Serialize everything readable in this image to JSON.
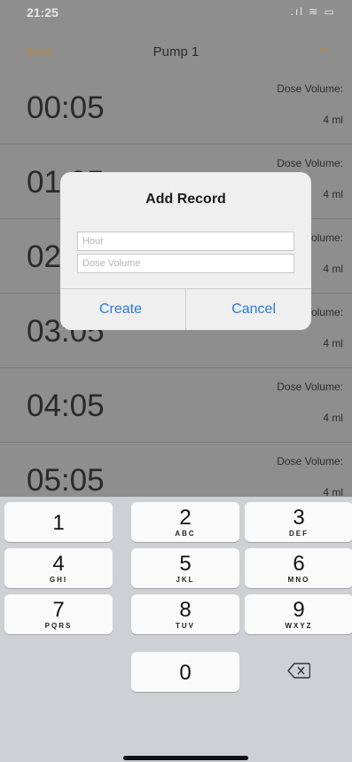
{
  "status": {
    "time": "21:25",
    "signal": ".ıl",
    "battery": "▢"
  },
  "nav": {
    "save_label": "Save",
    "title": "Pump 1",
    "add_label": "+"
  },
  "records": [
    {
      "time": "00:05",
      "dose_label": "Dose Volume:",
      "dose_value": "4 ml"
    },
    {
      "time": "01:05",
      "dose_label": "Dose Volume:",
      "dose_value": "4 ml"
    },
    {
      "time": "02:05",
      "dose_label": "Dose Volume:",
      "dose_value": "4 ml"
    },
    {
      "time": "03:05",
      "dose_label": "Dose Volume:",
      "dose_value": "4 ml"
    },
    {
      "time": "04:05",
      "dose_label": "Dose Volume:",
      "dose_value": "4 ml"
    },
    {
      "time": "05:05",
      "dose_label": "Dose Volume:",
      "dose_value": "4 ml"
    }
  ],
  "dialog": {
    "title": "Add Record",
    "hour_placeholder": "Hour",
    "dose_placeholder": "Dose Volume",
    "create_label": "Create",
    "cancel_label": "Cancel"
  },
  "keyboard": {
    "keys": [
      {
        "num": "1",
        "letters": ""
      },
      {
        "num": "2",
        "letters": "ABC"
      },
      {
        "num": "3",
        "letters": "DEF"
      },
      {
        "num": "4",
        "letters": "GHI"
      },
      {
        "num": "5",
        "letters": "JKL"
      },
      {
        "num": "6",
        "letters": "MNO"
      },
      {
        "num": "7",
        "letters": "PQRS"
      },
      {
        "num": "8",
        "letters": "TUV"
      },
      {
        "num": "9",
        "letters": "WXYZ"
      },
      {
        "num": "0",
        "letters": ""
      }
    ],
    "delete_icon": "backspace-icon"
  },
  "colors": {
    "accent": "#b78a3d",
    "button_blue": "#2d79d8"
  }
}
